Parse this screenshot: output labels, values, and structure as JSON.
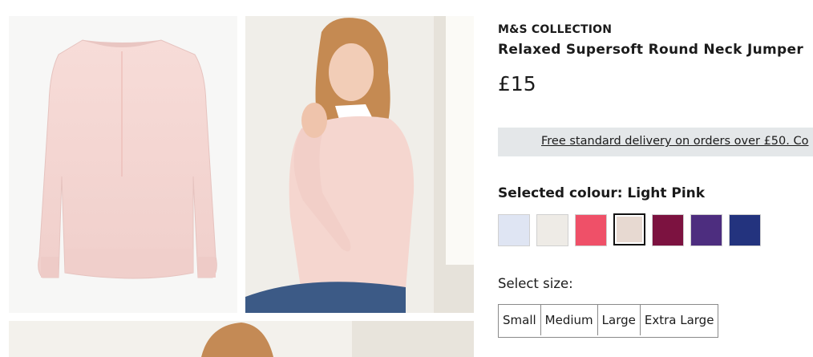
{
  "product": {
    "brand": "M&S COLLECTION",
    "title": "Relaxed Supersoft Round Neck Jumper",
    "price": "£15"
  },
  "delivery_banner": {
    "text": "Free standard delivery on orders over £50. Co"
  },
  "colour": {
    "label": "Selected colour: Light Pink",
    "swatches": [
      {
        "name": "light-blue",
        "color": "#dfe5f3"
      },
      {
        "name": "oatmeal",
        "color": "#eeebe6"
      },
      {
        "name": "coral-pink",
        "color": "#ef5068"
      },
      {
        "name": "light-pink",
        "color": "#e7d9d1",
        "selected": true
      },
      {
        "name": "burgundy",
        "color": "#7c1240"
      },
      {
        "name": "purple",
        "color": "#4d2d7f"
      },
      {
        "name": "navy",
        "color": "#23337e"
      }
    ]
  },
  "size": {
    "label": "Select size:",
    "options": [
      "Small",
      "Medium",
      "Large",
      "Extra Large"
    ]
  }
}
